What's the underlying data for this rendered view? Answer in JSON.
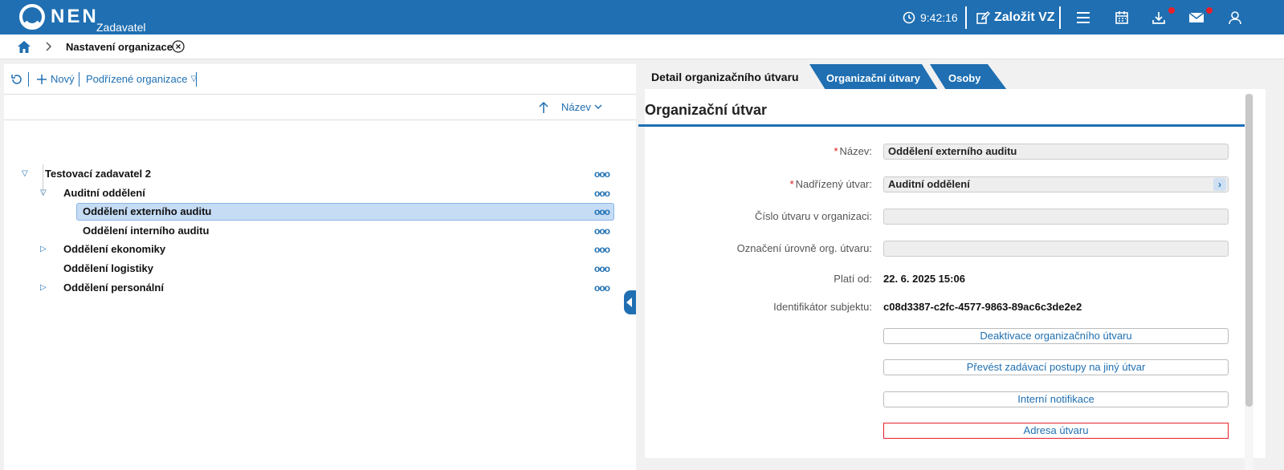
{
  "header": {
    "logo_text": "NEN",
    "logo_sub": "Zadavatel",
    "time": "9:42:16",
    "create_label": "Založit VZ",
    "icons": [
      "clock-icon",
      "edit-icon",
      "menu-icon",
      "calendar-icon",
      "download-icon",
      "mail-icon",
      "user-icon"
    ]
  },
  "breadcrumb": {
    "title": "Nastavení organizace"
  },
  "left": {
    "toolbar": {
      "new_label": "Nový",
      "sub_orgs_label": "Podřízené organizace"
    },
    "sort": {
      "label": "Název"
    },
    "tree": [
      {
        "label": "Testovací zadavatel 2",
        "level": 0,
        "expander": "expanded",
        "selected": false
      },
      {
        "label": "Auditní oddělení",
        "level": 1,
        "expander": "expanded",
        "selected": false
      },
      {
        "label": "Oddělení externího auditu",
        "level": 2,
        "expander": "none",
        "selected": true
      },
      {
        "label": "Oddělení interního auditu",
        "level": 2,
        "expander": "none",
        "selected": false
      },
      {
        "label": "Oddělení ekonomiky",
        "level": 1,
        "expander": "collapsed",
        "selected": false
      },
      {
        "label": "Oddělení logistiky",
        "level": 1,
        "expander": "none",
        "selected": false
      },
      {
        "label": "Oddělení personální",
        "level": 1,
        "expander": "collapsed",
        "selected": false
      }
    ],
    "more_label": "ooo"
  },
  "tabs": [
    "Detail organizačního útvaru",
    "Organizační útvary",
    "Osoby"
  ],
  "detail": {
    "title": "Organizační útvar",
    "fields": [
      {
        "label": "Název:",
        "required": true,
        "value": "Oddělení externího auditu"
      },
      {
        "label": "Nadřízený útvar:",
        "required": true,
        "value": "Auditní oddělení"
      },
      {
        "label": "Číslo útvaru v organizaci:",
        "required": false,
        "value": ""
      },
      {
        "label": "Označení úrovně org. útvaru:",
        "required": false,
        "value": ""
      },
      {
        "label": "Platí od:",
        "required": false,
        "value": "22. 6. 2025 15:06"
      },
      {
        "label": "Identifikátor subjektu:",
        "required": false,
        "value": "c08d3387-c2fc-4577-9863-89ac6c3de2e2"
      }
    ],
    "actions": [
      "Deaktivace organizačního útvaru",
      "Převést zadávací postupy na jiný útvar",
      "Interní notifikace",
      "Adresa útvaru"
    ]
  },
  "colors": {
    "brand": "#1f6fb2",
    "selected_row": "#c5dcf4",
    "required": "#d11111",
    "highlight_border": "#e8202a"
  }
}
